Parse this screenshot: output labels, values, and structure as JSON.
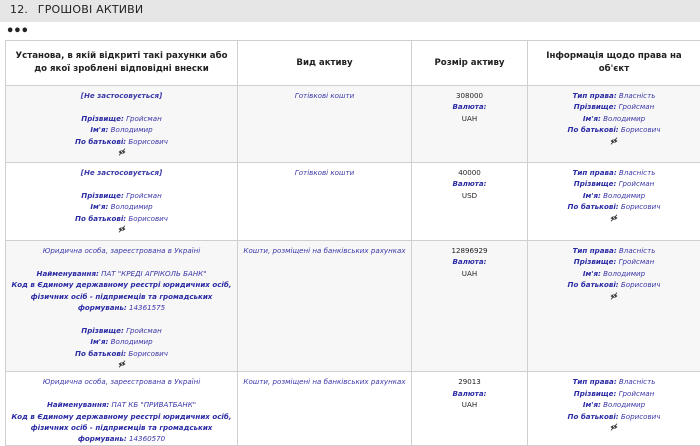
{
  "section": {
    "number": "12.",
    "title": "ГРОШОВІ АКТИВИ"
  },
  "dots": "•••",
  "headers": [
    "Установа, в якій відкриті такі рахунки або до якої зроблені відповідні внески",
    "Вид активу",
    "Розмір активу",
    "Інформація щодо права на об'єкт"
  ],
  "labels": {
    "surname": "Прізвище:",
    "name": "Ім'я:",
    "patronymic": "По батькові:",
    "currency": "Валюта:",
    "right_type": "Тип права:",
    "org_name": "Найменування:",
    "edrpou": "Код в Єдиному державному реєстрі юридичних осіб, фізичних осіб - підприємців та громадських формувань:"
  },
  "rows": [
    {
      "institution_na": "[Не застосовується]",
      "surname": "Гройсман",
      "name": "Володимир",
      "patronymic": "Борисович",
      "asset_type": "Готівкові кошти",
      "amount": "308000",
      "currency": "UAH",
      "right_type": "Власність",
      "owner_surname": "Гройсман",
      "owner_name": "Володимир",
      "owner_patronymic": "Борисович"
    },
    {
      "institution_na": "[Не застосовується]",
      "surname": "Гройсман",
      "name": "Володимир",
      "patronymic": "Борисович",
      "asset_type": "Готівкові кошти",
      "amount": "40000",
      "currency": "USD",
      "right_type": "Власність",
      "owner_surname": "Гройсман",
      "owner_name": "Володимир",
      "owner_patronymic": "Борисович"
    },
    {
      "entity_type": "Юридична особа, зареєстрована в Україні",
      "org_name": "ПАТ \"КРЕДІ АГРІКОЛЬ БАНК\"",
      "edrpou": "14361575",
      "surname": "Гройсман",
      "name": "Володимир",
      "patronymic": "Борисович",
      "asset_type": "Кошти, розміщені на банківських рахунках",
      "amount": "12896929",
      "currency": "UAH",
      "right_type": "Власність",
      "owner_surname": "Гройсман",
      "owner_name": "Володимир",
      "owner_patronymic": "Борисович"
    },
    {
      "entity_type": "Юридична особа, зареєстрована в Україні",
      "org_name": "ПАТ КБ \"ПРИВАТБАНК\"",
      "edrpou": "14360570",
      "asset_type": "Кошти, розміщені на банківських рахунках",
      "amount": "29013",
      "currency": "UAH",
      "right_type": "Власність",
      "owner_surname": "Гройсман",
      "owner_name": "Володимир",
      "owner_patronymic": "Борисович"
    }
  ]
}
